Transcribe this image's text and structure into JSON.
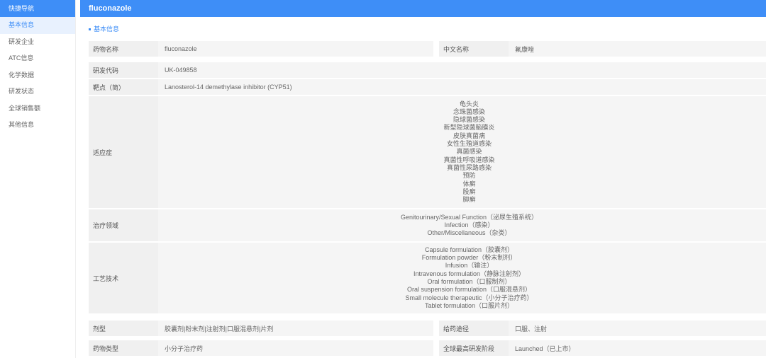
{
  "sidebar": {
    "header": "快捷导航",
    "items": [
      {
        "label": "基本信息",
        "active": true
      },
      {
        "label": "研发企业"
      },
      {
        "label": "ATC信息"
      },
      {
        "label": "化学数据"
      },
      {
        "label": "研发状态"
      },
      {
        "label": "全球销售额"
      },
      {
        "label": "其他信息"
      }
    ]
  },
  "header": {
    "title": "fluconazole"
  },
  "section": {
    "title": "基本信息"
  },
  "fields": {
    "drug_name": {
      "label": "药物名称",
      "value": "fluconazole"
    },
    "cn_name": {
      "label": "中文名称",
      "value": "氟康唑"
    },
    "dev_code": {
      "label": "研发代码",
      "value": "UK-049858"
    },
    "target": {
      "label": "靶点（简）",
      "value": "Lanosterol-14 demethylase inhibitor (CYP51)"
    },
    "indication": {
      "label": "适应症",
      "values": [
        "龟头炎",
        "念珠菌感染",
        "隐球菌感染",
        "新型隐球菌脑膜炎",
        "皮肤真菌病",
        "女性生殖道感染",
        "真菌感染",
        "真菌性呼吸道感染",
        "真菌性尿路感染",
        "预防",
        "体癣",
        "股癣",
        "脚癣"
      ]
    },
    "therapeutic_area": {
      "label": "治疗领域",
      "values": [
        "Genitourinary/Sexual Function（泌尿生殖系统）",
        "Infection（感染）",
        "Other/Miscellaneous（杂类）"
      ]
    },
    "technology": {
      "label": "工艺技术",
      "values": [
        "Capsule formulation（胶囊剂）",
        "Formulation powder（粉末制剂）",
        "Infusion（输注）",
        "Intravenous formulation（静脉注射剂）",
        "Oral formulation（口服制剂）",
        "Oral suspension formulation（口服混悬剂）",
        "Small molecule therapeutic（小分子治疗药）",
        "Tablet formulation（口服片剂）"
      ]
    },
    "dosage_form": {
      "label": "剂型",
      "value": "胶囊剂|粉末剂|注射剂|口服混悬剂|片剂"
    },
    "route": {
      "label": "给药途径",
      "value": "口服、注射"
    },
    "drug_type": {
      "label": "药物类型",
      "value": "小分子治疗药"
    },
    "highest_phase": {
      "label": "全球最高研发阶段",
      "value": "Launched（已上市）"
    }
  },
  "colors": {
    "accent": "#3e8ef7",
    "label_bg": "#f0f0f0",
    "value_bg": "#f5f5f5"
  }
}
